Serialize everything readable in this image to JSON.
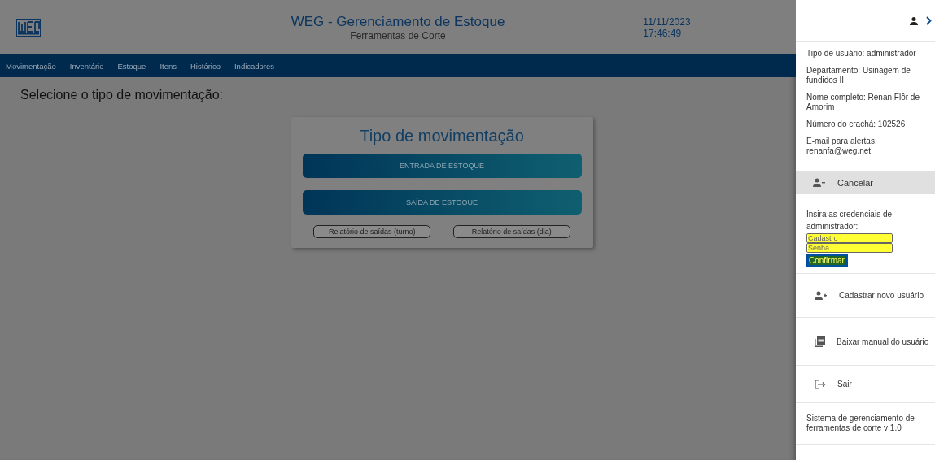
{
  "header": {
    "title": "WEG - Gerenciamento de Estoque",
    "subtitle": "Ferramentas de Corte",
    "date": "11/11/2023",
    "time": "17:46:49"
  },
  "nav": [
    {
      "label": "Movimentação"
    },
    {
      "label": "Inventário"
    },
    {
      "label": "Estoque"
    },
    {
      "label": "Itens"
    },
    {
      "label": "Histórico"
    },
    {
      "label": "Indicadores"
    }
  ],
  "heading": "Selecione o tipo de movimentação:",
  "card": {
    "title": "Tipo de movimentação",
    "primary_buttons": [
      "ENTRADA DE ESTOQUE",
      "SAÍDA DE ESTOQUE"
    ],
    "report_buttons": [
      "Relatório de saídas (turno)",
      "Relatório de saídas (dia)"
    ]
  },
  "drawer": {
    "info": [
      "Tipo de usuário: administrador",
      "Departamento: Usinagem de fundidos II",
      "Nome completo: Renan Flôr de Amorim",
      "Número do crachá: 102526",
      "E-mail para alertas: renanfa@weg.net"
    ],
    "cancel": "Cancelar",
    "credentials": {
      "prompt": "Insira as credenciais de administrador:",
      "fields": [
        {
          "placeholder": "Cadastro"
        },
        {
          "placeholder": "Senha"
        }
      ],
      "confirm": "Confirmar"
    },
    "actions": [
      {
        "kind": "add-user",
        "label": "Cadastrar novo usuário"
      },
      {
        "kind": "pdf",
        "label": "Baixar manual do usuário"
      },
      {
        "kind": "logout",
        "label": "Sair"
      }
    ],
    "footer": "Sistema de gerenciamento de ferramentas de corte v 1.0"
  }
}
